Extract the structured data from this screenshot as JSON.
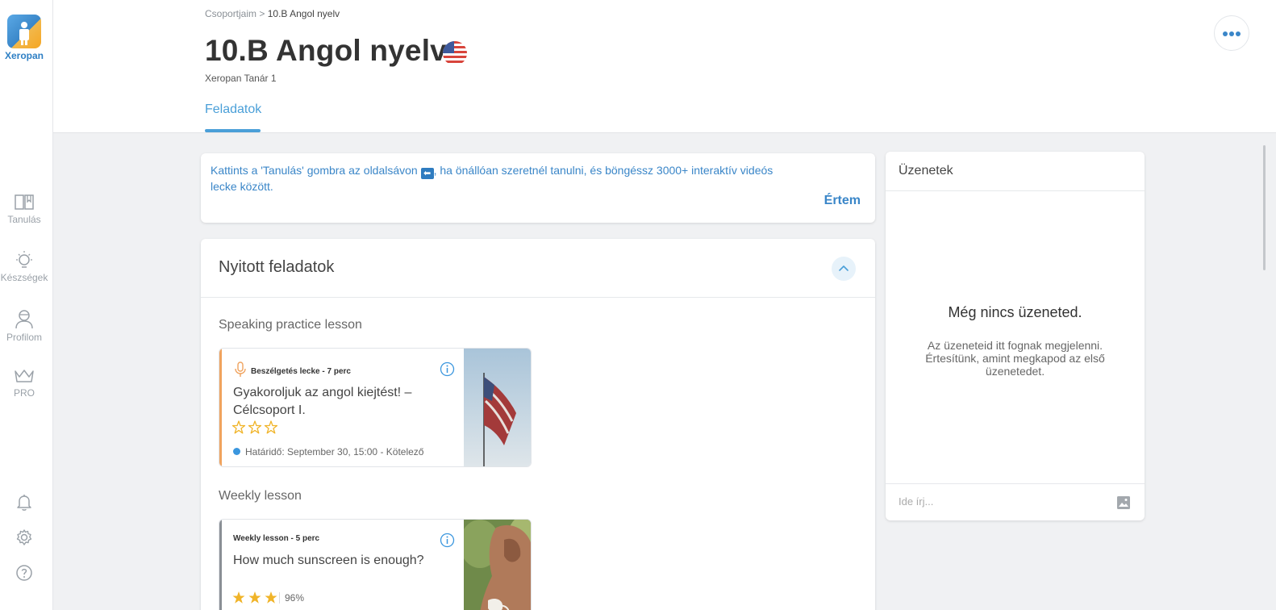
{
  "sidebar": {
    "logo_text": "Xeropan",
    "items": [
      {
        "label": "Tanulás",
        "icon": "book-icon"
      },
      {
        "label": "Készségek",
        "icon": "lightbulb-icon"
      },
      {
        "label": "Profilom",
        "icon": "user-icon"
      },
      {
        "label": "PRO",
        "icon": "crown-icon"
      }
    ],
    "bottom_icons": [
      "bell-icon",
      "gear-icon",
      "help-icon"
    ]
  },
  "header": {
    "breadcrumb_parent": "Csoportjaim",
    "breadcrumb_sep": ">",
    "breadcrumb_current": "10.B Angol nyelv",
    "title": "10.B Angol nyelv",
    "teacher": "Xeropan Tanár 1",
    "tab": "Feladatok"
  },
  "banner": {
    "text_before": "Kattints a 'Tanulás' gombra az oldalsávon",
    "arrow": "⬅",
    "text_after": ", ha önállóan szeretnél tanulni, és böngéssz 3000+ interaktív videós lecke között.",
    "button": "Értem"
  },
  "tasks": {
    "title": "Nyitott feladatok",
    "sections": [
      {
        "label": "Speaking practice lesson",
        "card": {
          "type": "Beszélgetés lecke - 7 perc",
          "title": "Gyakoroljuk az angol kiejtést! – Célcsoport I.",
          "stars_filled": 0,
          "stars_total": 3,
          "deadline": "Határidő: September 30, 15:00 - Kötelező",
          "accent_color": "#f0a35e"
        }
      },
      {
        "label": "Weekly lesson",
        "card": {
          "type": "Weekly lesson - 5 perc",
          "title": "How much sunscreen is enough?",
          "stars_filled": 3,
          "stars_total": 3,
          "score": "96%",
          "accent_color": "#8a8f95"
        }
      }
    ]
  },
  "messages": {
    "header": "Üzenetek",
    "empty_title": "Még nincs üzeneted.",
    "empty_text": "Az üzeneteid itt fognak megjelenni. Értesítünk, amint megkapod az első üzenetedet.",
    "input_placeholder": "Ide írj..."
  },
  "colors": {
    "accent": "#3a86c8",
    "star": "#f0b429",
    "background": "#f0f1f3"
  }
}
